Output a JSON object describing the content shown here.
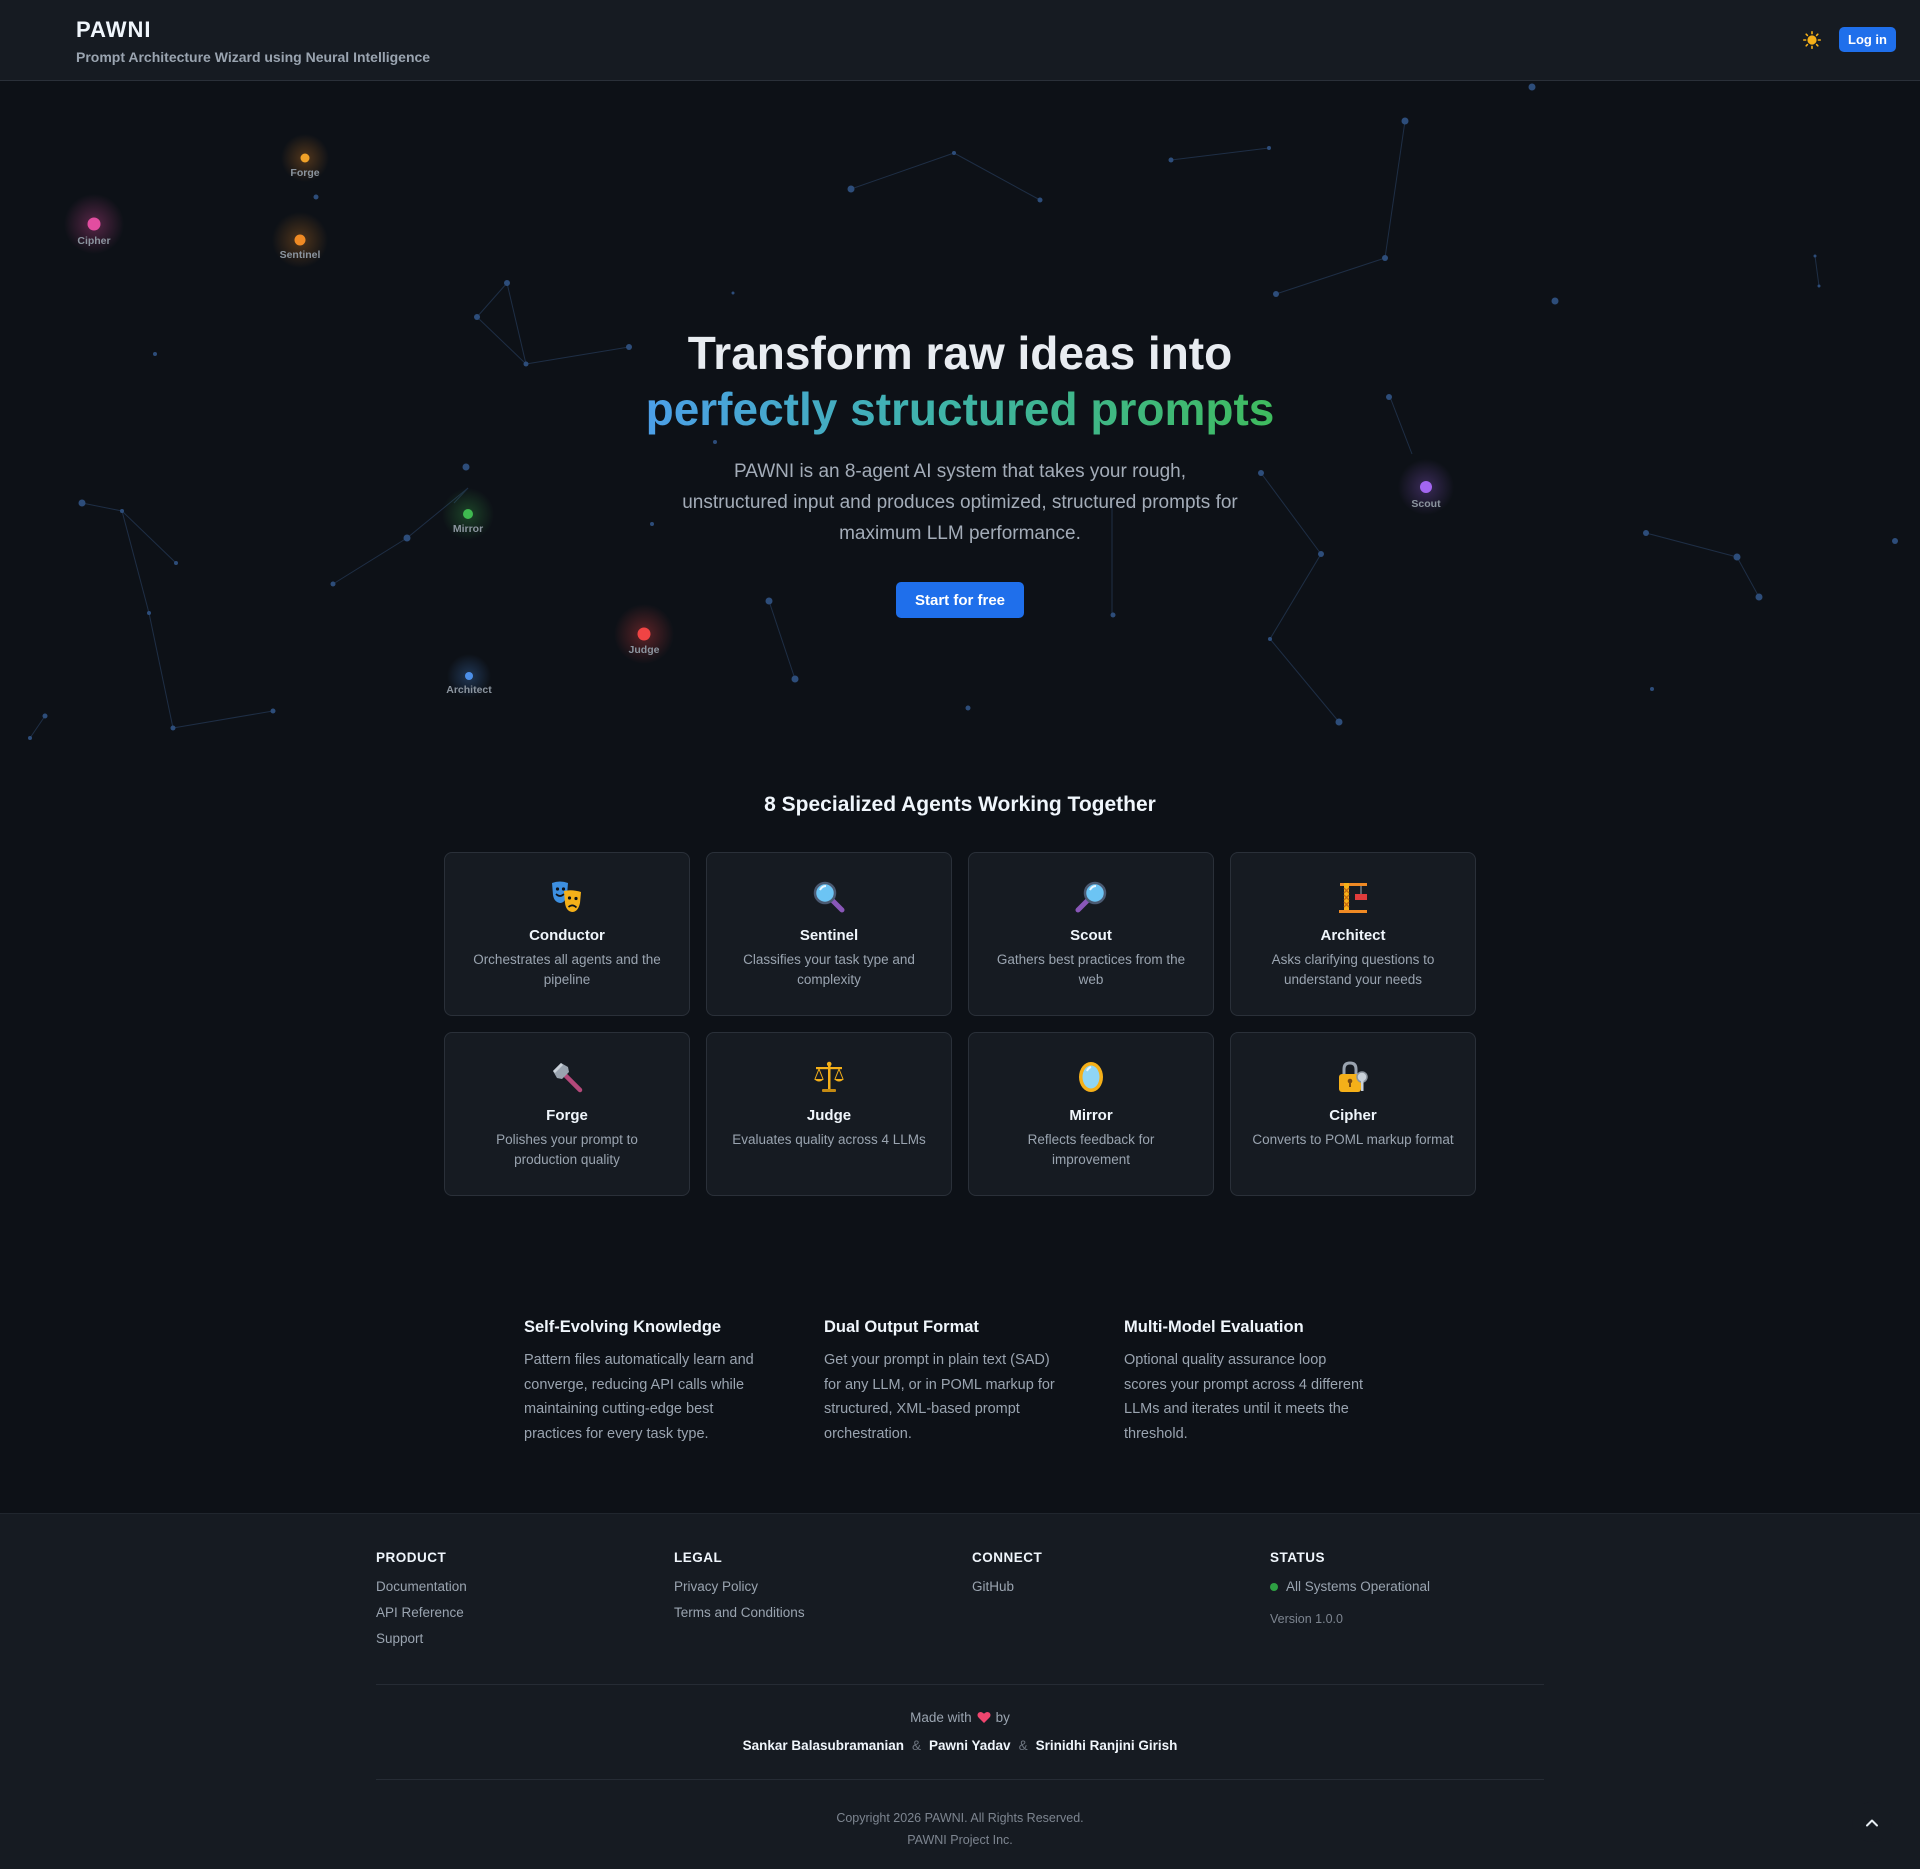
{
  "header": {
    "brand": "PAWNI",
    "tagline": "Prompt Architecture Wizard using Neural Intelligence",
    "theme_icon": "sun-icon",
    "login_label": "Log in"
  },
  "hero": {
    "title_line1": "Transform raw ideas into",
    "title_line2": "perfectly structured prompts",
    "description": "PAWNI is an 8-agent AI system that takes your rough, unstructured input and produces optimized, structured prompts for maximum LLM performance.",
    "cta_label": "Start for free",
    "network_nodes": [
      "Forge",
      "Cipher",
      "Sentinel",
      "Mirror",
      "Judge",
      "Architect",
      "Scout"
    ]
  },
  "agents": {
    "heading": "8 Specialized Agents Working Together",
    "items": [
      {
        "name": "Conductor",
        "desc": "Orchestrates all agents and the pipeline",
        "icon": "theater-masks-icon"
      },
      {
        "name": "Sentinel",
        "desc": "Classifies your task type and complexity",
        "icon": "magnifier-left-icon"
      },
      {
        "name": "Scout",
        "desc": "Gathers best practices from the web",
        "icon": "magnifier-right-icon"
      },
      {
        "name": "Architect",
        "desc": "Asks clarifying questions to understand your needs",
        "icon": "construction-crane-icon"
      },
      {
        "name": "Forge",
        "desc": "Polishes your prompt to production quality",
        "icon": "hammer-icon"
      },
      {
        "name": "Judge",
        "desc": "Evaluates quality across 4 LLMs",
        "icon": "scales-icon"
      },
      {
        "name": "Mirror",
        "desc": "Reflects feedback for improvement",
        "icon": "mirror-icon"
      },
      {
        "name": "Cipher",
        "desc": "Converts to POML markup format",
        "icon": "lock-key-icon"
      }
    ]
  },
  "features": [
    {
      "title": "Self-Evolving Knowledge",
      "text": "Pattern files automatically learn and converge, reducing API calls while maintaining cutting-edge best practices for every task type."
    },
    {
      "title": "Dual Output Format",
      "text": "Get your prompt in plain text (SAD) for any LLM, or in POML markup for structured, XML-based prompt orchestration."
    },
    {
      "title": "Multi-Model Evaluation",
      "text": "Optional quality assurance loop scores your prompt across 4 different LLMs and iterates until it meets the threshold."
    }
  ],
  "footer": {
    "product": {
      "title": "PRODUCT",
      "links": [
        "Documentation",
        "API Reference",
        "Support"
      ]
    },
    "legal": {
      "title": "LEGAL",
      "links": [
        "Privacy Policy",
        "Terms and Conditions"
      ]
    },
    "connect": {
      "title": "CONNECT",
      "links": [
        "GitHub"
      ]
    },
    "status": {
      "title": "STATUS",
      "text": "All Systems Operational",
      "version": "Version 1.0.0"
    },
    "made_with_prefix": "Made with",
    "made_with_suffix": "by",
    "authors": [
      "Sankar Balasubramanian",
      "Pawni Yadav",
      "Srinidhi Ranjini Girish"
    ],
    "separator": "&",
    "copyright": "Copyright 2026 PAWNI. All Rights Reserved.",
    "company": "PAWNI Project Inc."
  },
  "colors": {
    "accent": "#1f6feb",
    "background": "#0d1117",
    "surface": "#161b22",
    "status_ok": "#2ea043"
  }
}
